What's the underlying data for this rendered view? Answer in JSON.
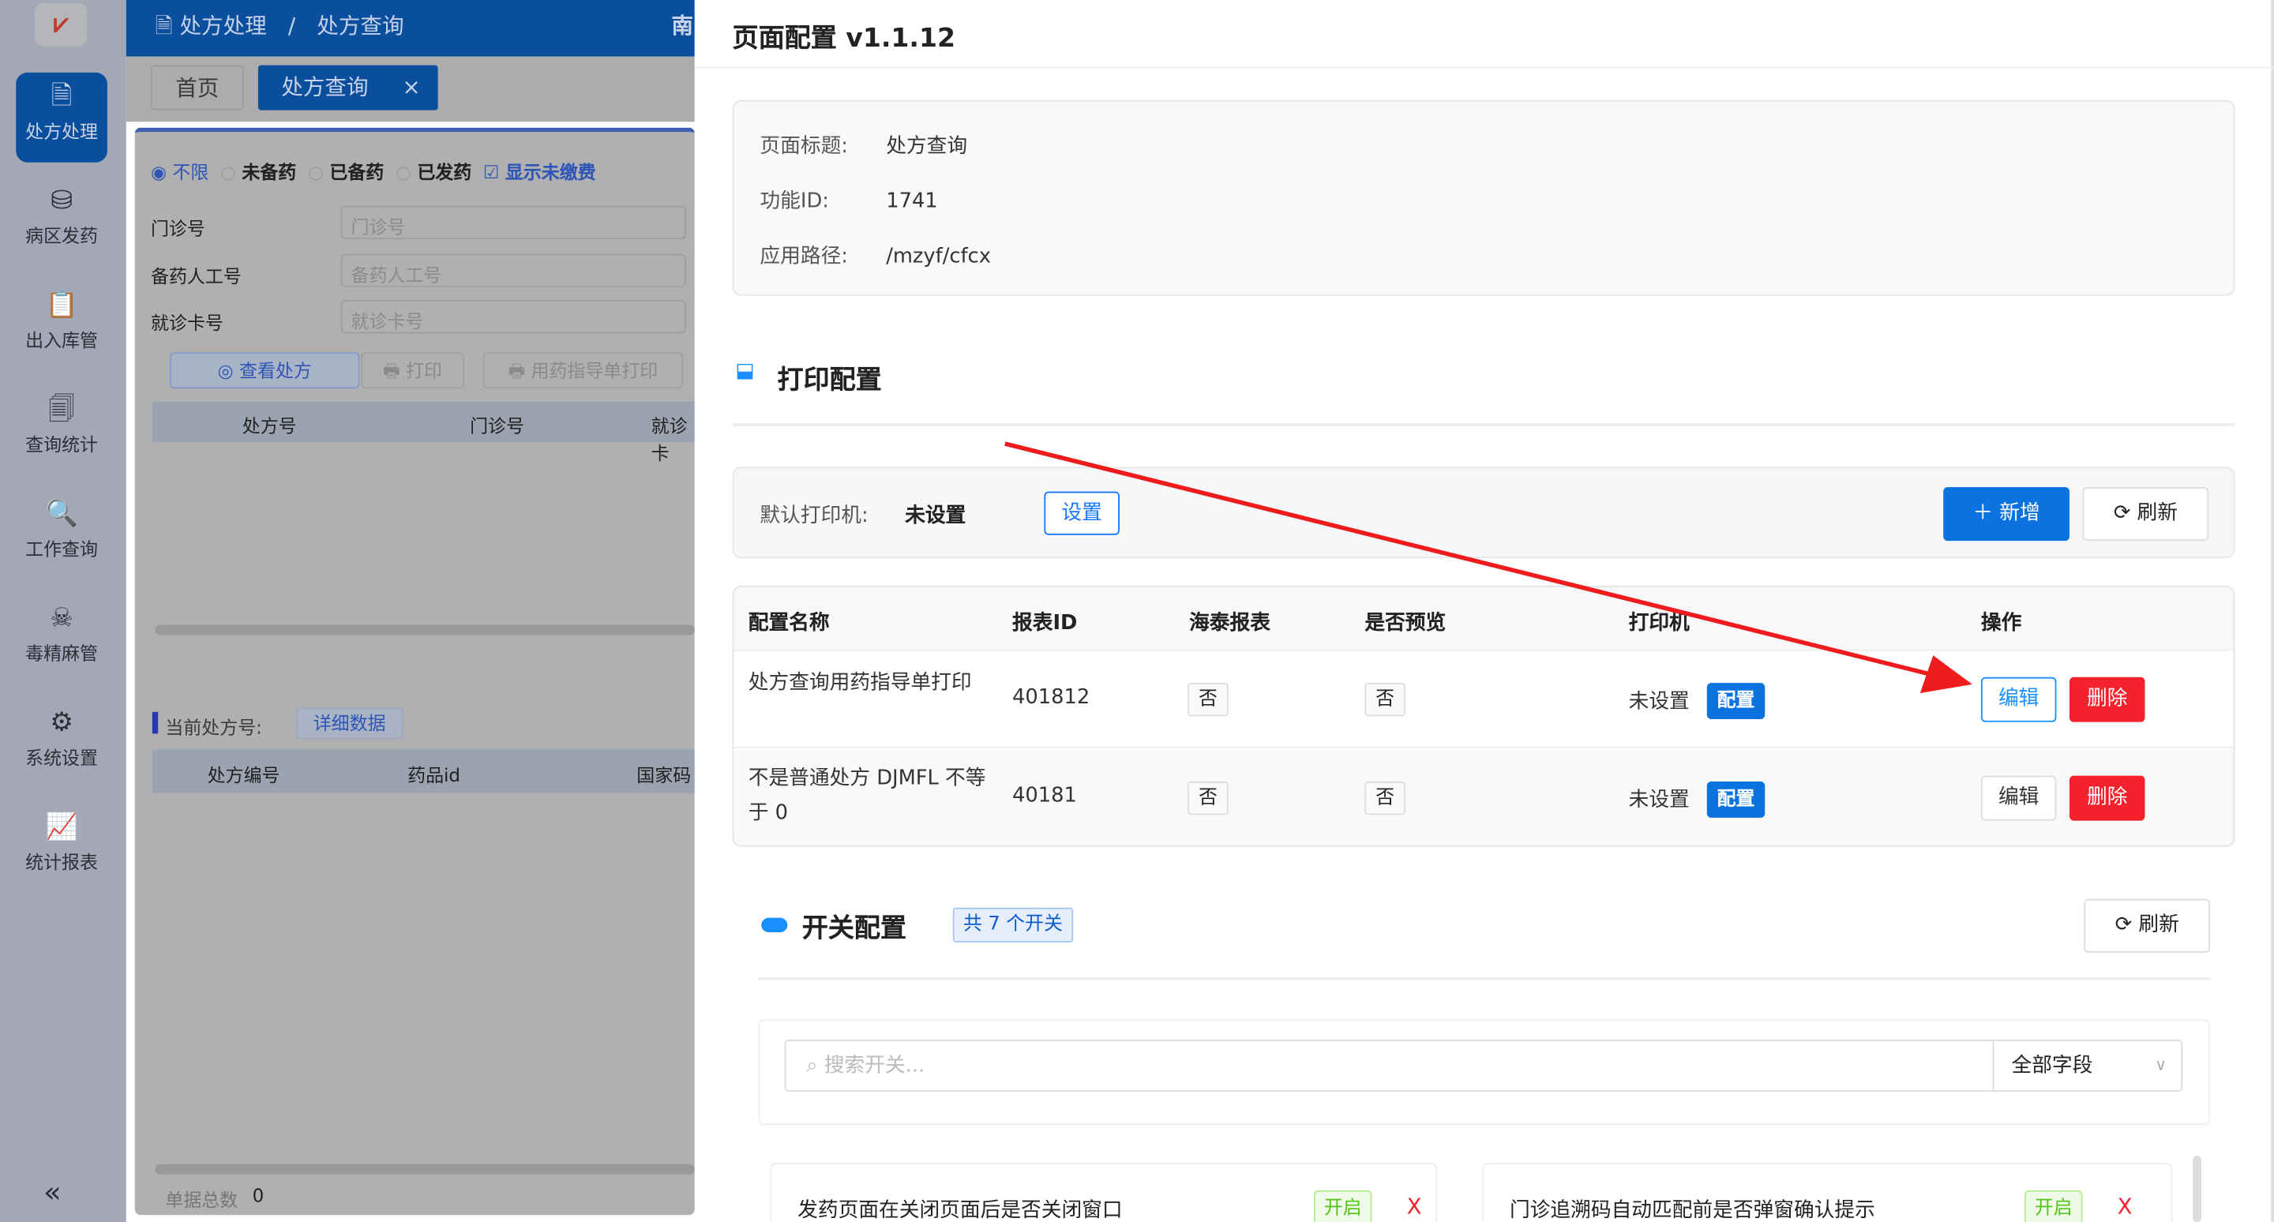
{
  "app": {
    "logo": "logo",
    "sidebar": [
      {
        "label": "处方处理",
        "icon": "prescription-icon",
        "active": true
      },
      {
        "label": "病区发药",
        "icon": "medicine-bottle-icon"
      },
      {
        "label": "出入库管",
        "icon": "inventory-icon"
      },
      {
        "label": "查询统计",
        "icon": "query-stats-icon"
      },
      {
        "label": "工作查询",
        "icon": "work-search-icon"
      },
      {
        "label": "毒精麻管",
        "icon": "skull-icon"
      },
      {
        "label": "系统设置",
        "icon": "settings-icon"
      },
      {
        "label": "统计报表",
        "icon": "report-chart-icon"
      }
    ],
    "collapse": "«",
    "breadcrumb": [
      "处方处理",
      "/",
      "处方查询"
    ],
    "header_right": "南",
    "tabs": [
      {
        "label": "首页"
      },
      {
        "label": "处方查询",
        "close": "×"
      }
    ],
    "filters": {
      "radios": [
        "不限",
        "未备药",
        "已备药",
        "已发药"
      ],
      "checkbox": "显示未缴费"
    },
    "fields": [
      {
        "label": "门诊号",
        "placeholder": "门诊号"
      },
      {
        "label": "备药人工号",
        "placeholder": "备药人工号"
      },
      {
        "label": "就诊卡号",
        "placeholder": "就诊卡号"
      }
    ],
    "buttons": {
      "view": "查看处方",
      "print": "打印",
      "guide_print": "用药指导单打印"
    },
    "table1_headers": [
      "处方号",
      "门诊号",
      "就诊卡"
    ],
    "current_label": "当前处方号:",
    "detail_btn": "详细数据",
    "table2_headers": [
      "处方编号",
      "药品id",
      "国家码"
    ],
    "total_label": "单据总数",
    "total_value": "0"
  },
  "panel": {
    "title": "页面配置 v1.1.12",
    "info": [
      {
        "k": "页面标题:",
        "v": "处方查询"
      },
      {
        "k": "功能ID:",
        "v": "1741"
      },
      {
        "k": "应用路径:",
        "v": "/mzyf/cfcx"
      }
    ],
    "print_section": "打印配置",
    "default_printer_label": "默认打印机:",
    "default_printer_value": "未设置",
    "set_btn": "设置",
    "add_btn": "新增",
    "refresh_btn": "刷新",
    "headers": [
      "配置名称",
      "报表ID",
      "海泰报表",
      "是否预览",
      "打印机",
      "操作"
    ],
    "rows": [
      {
        "name": "处方查询用药指导单打印",
        "id": "401812",
        "haitai": "否",
        "preview": "否",
        "printer": "未设置",
        "cfg": "配置",
        "edit": "编辑",
        "del": "删除"
      },
      {
        "name": "不是普通处方 DJMFL 不等于 0",
        "id": "40181",
        "haitai": "否",
        "preview": "否",
        "printer": "未设置",
        "cfg": "配置",
        "edit": "编辑",
        "del": "删除"
      }
    ],
    "switch_section": "开关配置",
    "switch_count": "共 7 个开关",
    "switch_refresh": "刷新",
    "search_placeholder": "搜索开关...",
    "field_select": "全部字段",
    "switches": [
      {
        "label": "发药页面在关闭页面后是否关闭窗口",
        "state": "开启",
        "remove": "X"
      },
      {
        "label": "门诊追溯码自动匹配前是否弹窗确认提示",
        "state": "开启",
        "remove": "X"
      }
    ]
  },
  "colors": {
    "brand": "#0a73e0",
    "danger": "#f5222d",
    "success": "#52c41a",
    "arrow": "#ee1c1c"
  }
}
